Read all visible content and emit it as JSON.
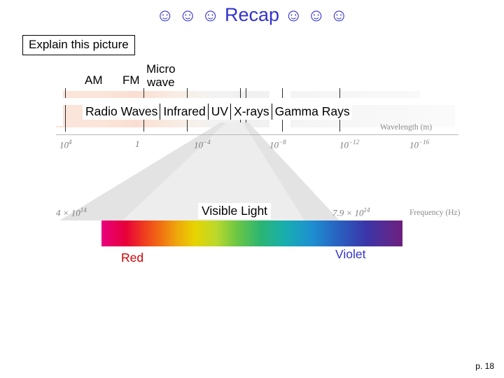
{
  "slide": {
    "title": {
      "smileys_left": "☺ ☺ ☺",
      "text": "Recap",
      "smileys_right": "☺ ☺ ☺"
    },
    "explain_box": "Explain this picture",
    "page_number": "p. 18"
  },
  "band_labels": {
    "am": "AM",
    "fm": "FM",
    "micro_line1": "Micro",
    "micro_line2": "wave"
  },
  "spectrum_regions": [
    {
      "label": "Radio Waves"
    },
    {
      "label": "Infrared"
    },
    {
      "label": "UV"
    },
    {
      "label": "X-rays"
    },
    {
      "label": "Gamma Rays"
    }
  ],
  "visible": {
    "label": "Visible Light",
    "red": "Red",
    "violet": "Violet"
  },
  "axis": {
    "wavelength_caption": "Wavelength (m)",
    "frequency_caption": "Frequency (Hz)",
    "wavelength_ticks": [
      {
        "mantissa": "10",
        "exponent": "4"
      },
      {
        "mantissa": "1",
        "exponent": ""
      },
      {
        "mantissa": "10",
        "exponent": "−4"
      },
      {
        "mantissa": "10",
        "exponent": "−8"
      },
      {
        "mantissa": "10",
        "exponent": "−12"
      },
      {
        "mantissa": "10",
        "exponent": "−16"
      }
    ],
    "freq_left": "4 × 10",
    "freq_left_exp": "14",
    "freq_right": "7.9 × 10",
    "freq_right_exp": "14"
  },
  "colors": {
    "title": "#3333cc",
    "red_label": "#cc0000",
    "violet_label": "#3333cc"
  }
}
